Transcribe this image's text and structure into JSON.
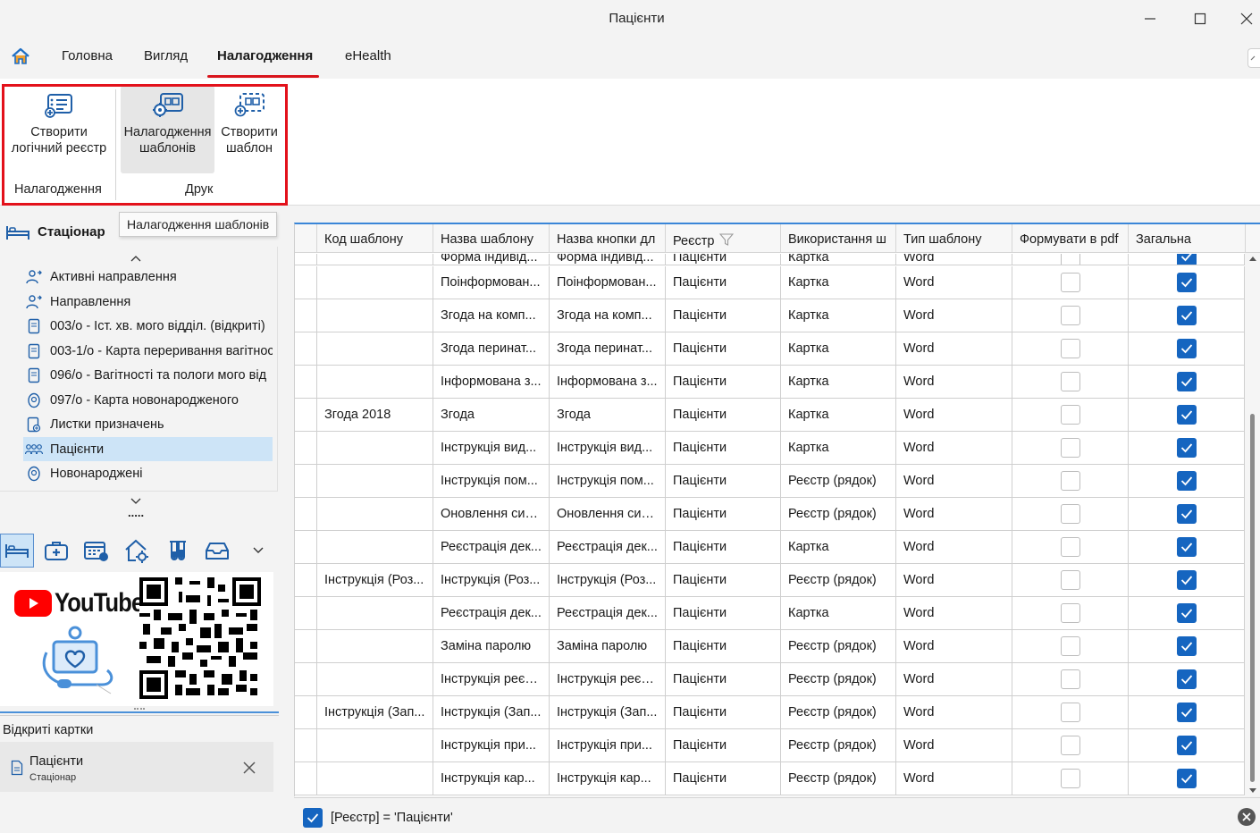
{
  "window": {
    "title": "Пацієнти"
  },
  "tabs": [
    {
      "label": "Головна"
    },
    {
      "label": "Вигляд"
    },
    {
      "label": "Налагодження"
    },
    {
      "label": "eHealth"
    }
  ],
  "ribbon": {
    "create_logical_registry": {
      "line1": "Створити",
      "line2": "логічний реєстр"
    },
    "template_settings": {
      "line1": "Налагодження",
      "line2": "шаблонів"
    },
    "create_template": {
      "line1": "Створити",
      "line2": "шаблон"
    },
    "group_settings": "Налагодження",
    "group_print": "Друк"
  },
  "tooltip": "Налагодження шаблонів",
  "left_panel": {
    "department": "Стаціонар",
    "nav_items": [
      {
        "label": "Активні направлення",
        "icon": "people-link-icon"
      },
      {
        "label": "Направлення",
        "icon": "people-link-icon"
      },
      {
        "label": "003/о - Іст. хв. мого відділ. (відкриті)",
        "icon": "document-icon"
      },
      {
        "label": "003-1/о - Карта переривання вагітнос",
        "icon": "document-icon"
      },
      {
        "label": "096/о - Вагітності та пологи мого від",
        "icon": "document-icon"
      },
      {
        "label": "097/о - Карта новонародженого",
        "icon": "baby-icon"
      },
      {
        "label": "Листки призначень",
        "icon": "prescription-icon"
      },
      {
        "label": "Пацієнти",
        "icon": "patients-icon",
        "selected": true
      },
      {
        "label": "Новонароджені",
        "icon": "baby-icon"
      }
    ],
    "more_dots": ".....",
    "open_cards_title": "Відкриті картки",
    "open_card": {
      "title": "Пацієнти",
      "subtitle": "Стаціонар"
    },
    "promo_text": "YouTube"
  },
  "grid": {
    "columns": [
      "Код шаблону",
      "Назва шаблону",
      "Назва кнопки дл",
      "Реєстр",
      "Використання ш",
      "Тип шаблону",
      "Формувати в pdf",
      "Загальна"
    ],
    "partial_row": [
      "",
      "Форма індивід...",
      "Форма індивід...",
      "Пацієнти",
      "Картка",
      "Word"
    ],
    "rows": [
      {
        "code": "",
        "name": "Поінформован...",
        "button": "Поінформован...",
        "registry": "Пацієнти",
        "usage": "Картка",
        "type": "Word",
        "pdf": false,
        "general": true
      },
      {
        "code": "",
        "name": "Згода на комп...",
        "button": "Згода на комп...",
        "registry": "Пацієнти",
        "usage": "Картка",
        "type": "Word",
        "pdf": false,
        "general": true
      },
      {
        "code": "",
        "name": "Згода перинат...",
        "button": "Згода перинат...",
        "registry": "Пацієнти",
        "usage": "Картка",
        "type": "Word",
        "pdf": false,
        "general": true
      },
      {
        "code": "",
        "name": "Інформована з...",
        "button": "Інформована з...",
        "registry": "Пацієнти",
        "usage": "Картка",
        "type": "Word",
        "pdf": false,
        "general": true
      },
      {
        "code": "Згода 2018",
        "name": "Згода",
        "button": "Згода",
        "registry": "Пацієнти",
        "usage": "Картка",
        "type": "Word",
        "pdf": false,
        "general": true
      },
      {
        "code": "",
        "name": "Інструкція вид...",
        "button": "Інструкція вид...",
        "registry": "Пацієнти",
        "usage": "Картка",
        "type": "Word",
        "pdf": false,
        "general": true
      },
      {
        "code": "",
        "name": "Інструкція пом...",
        "button": "Інструкція пом...",
        "registry": "Пацієнти",
        "usage": "Реєстр (рядок)",
        "type": "Word",
        "pdf": false,
        "general": true
      },
      {
        "code": "",
        "name": "Оновлення сис...",
        "button": "Оновлення сис...",
        "registry": "Пацієнти",
        "usage": "Реєстр (рядок)",
        "type": "Word",
        "pdf": false,
        "general": true
      },
      {
        "code": "",
        "name": "Реєстрація дек...",
        "button": "Реєстрація дек...",
        "registry": "Пацієнти",
        "usage": "Картка",
        "type": "Word",
        "pdf": false,
        "general": true
      },
      {
        "code": "Інструкція (Роз...",
        "name": "Інструкція (Роз...",
        "button": "Інструкція (Роз...",
        "registry": "Пацієнти",
        "usage": "Реєстр (рядок)",
        "type": "Word",
        "pdf": false,
        "general": true
      },
      {
        "code": "",
        "name": "Реєстрація дек...",
        "button": "Реєстрація дек...",
        "registry": "Пацієнти",
        "usage": "Картка",
        "type": "Word",
        "pdf": false,
        "general": true
      },
      {
        "code": "",
        "name": "Заміна паролю",
        "button": "Заміна паролю",
        "registry": "Пацієнти",
        "usage": "Реєстр (рядок)",
        "type": "Word",
        "pdf": false,
        "general": true
      },
      {
        "code": "",
        "name": "Інструкція реєс...",
        "button": "Інструкція реєс...",
        "registry": "Пацієнти",
        "usage": "Реєстр (рядок)",
        "type": "Word",
        "pdf": false,
        "general": true
      },
      {
        "code": "Інструкція (Зап...",
        "name": "Інструкція (Зап...",
        "button": "Інструкція (Зап...",
        "registry": "Пацієнти",
        "usage": "Реєстр (рядок)",
        "type": "Word",
        "pdf": false,
        "general": true
      },
      {
        "code": "",
        "name": "Інструкція при...",
        "button": "Інструкція при...",
        "registry": "Пацієнти",
        "usage": "Реєстр (рядок)",
        "type": "Word",
        "pdf": false,
        "general": true
      },
      {
        "code": "",
        "name": "Інструкція кар...",
        "button": "Інструкція кар...",
        "registry": "Пацієнти",
        "usage": "Реєстр (рядок)",
        "type": "Word",
        "pdf": false,
        "general": true
      }
    ]
  },
  "filter": {
    "enabled": true,
    "expression": "[Реєстр] = 'Пацієнти'"
  },
  "colors": {
    "accent": "#1565c0",
    "tab_underline": "#d9141b",
    "highlight_box": "#e3111b",
    "selected_row": "#cde4f7"
  }
}
